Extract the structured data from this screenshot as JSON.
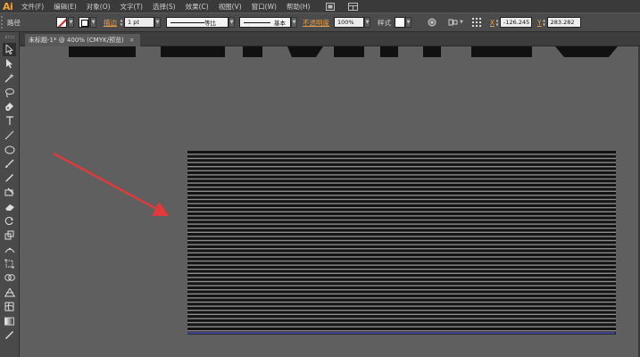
{
  "app": {
    "logo": "Ai"
  },
  "menu": {
    "items": [
      "文件(F)",
      "编辑(E)",
      "对象(O)",
      "文字(T)",
      "选择(S)",
      "效果(C)",
      "视图(V)",
      "窗口(W)",
      "帮助(H)"
    ],
    "icons": [
      "bridge-icon",
      "arrange-documents-icon"
    ]
  },
  "control_bar": {
    "object_type": "路径",
    "fill": "none",
    "stroke_label": "描边",
    "stroke_weight": "1 pt",
    "profile_label": "等比",
    "brush_label": "基本",
    "opacity_label": "不透明度",
    "opacity_value": "100%",
    "style_label": "样式",
    "x_label": "X",
    "x_value": "-126.245",
    "y_label": "Y",
    "y_value": "283.282"
  },
  "document": {
    "tab_title": "未标题-1* @ 400% (CMYK/预览)",
    "close_symbol": "×"
  },
  "colors": {
    "menubar": "#3a3a3a",
    "canvas": "#5f5f5f",
    "stripe_dark": "#141414",
    "stripe_light": "#8c8c8c",
    "arrow": "#e23a3a",
    "selection": "#5a5ad8"
  }
}
